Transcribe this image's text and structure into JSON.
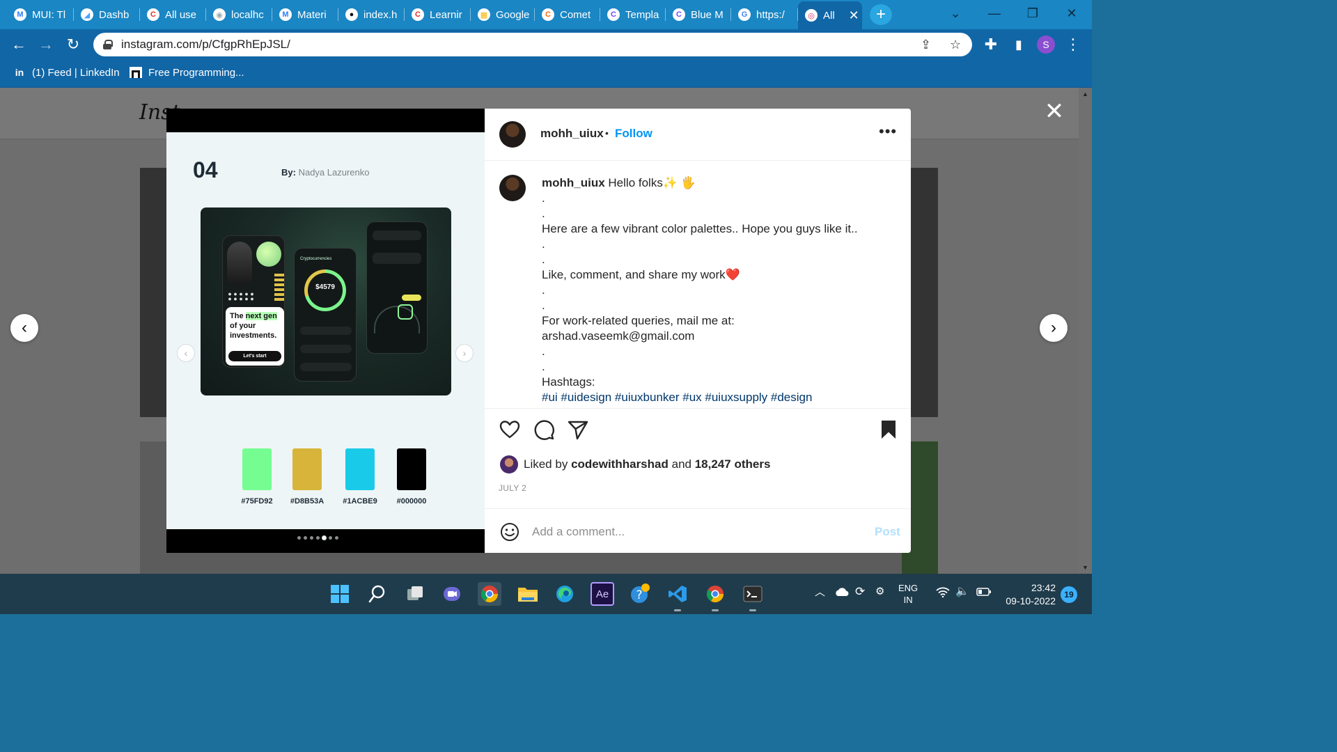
{
  "browser": {
    "tabs": [
      {
        "title": "MUI: Tl",
        "icon": "mui-icon",
        "color": "#2a7fff"
      },
      {
        "title": "Dashb",
        "icon": "dashboard-icon",
        "color": "#4da3ff"
      },
      {
        "title": "All use",
        "icon": "c-icon",
        "color": "#e0322b"
      },
      {
        "title": "localhc",
        "icon": "globe-icon",
        "color": "#9aa"
      },
      {
        "title": "Materi",
        "icon": "mui-icon",
        "color": "#2a7fff"
      },
      {
        "title": "index.h",
        "icon": "github-icon",
        "color": "#111"
      },
      {
        "title": "Learnir",
        "icon": "c-icon",
        "color": "#e0322b"
      },
      {
        "title": "Google",
        "icon": "google-sheets-icon",
        "color": "#f4b400"
      },
      {
        "title": "Comet",
        "icon": "comet-icon",
        "color": "#ff6a00"
      },
      {
        "title": "Templa",
        "icon": "c-icon",
        "color": "#6c4cff"
      },
      {
        "title": "Blue M",
        "icon": "c-icon",
        "color": "#6c4cff"
      },
      {
        "title": "https:/",
        "icon": "google-icon",
        "color": "#4285f4"
      },
      {
        "title": "All",
        "icon": "instagram-icon",
        "color": "#e1306c"
      }
    ],
    "url": "instagram.com/p/CfgpRhEpJSL/",
    "bookmarks": [
      {
        "label": "(1) Feed | LinkedIn",
        "icon": "linkedin-icon"
      },
      {
        "label": "Free Programming...",
        "icon": "bookmark-page-icon"
      }
    ],
    "profile_initial": "S"
  },
  "backdrop": {
    "logo_text": "Inst"
  },
  "post": {
    "username": "mohh_uiux",
    "follow_label": "Follow",
    "slide": {
      "number": "04",
      "by_label": "By:",
      "author": "Nadya Lazurenko",
      "mock_tagline_pre": "The ",
      "mock_tagline_hl": "next gen",
      "mock_tagline_post": " of your investments.",
      "mock_cta": "Let's start",
      "mock_amount": "$4579",
      "mock_section": "Cryptocurrencies",
      "swatches": [
        {
          "hex": "#75FD92",
          "color": "#75FD92"
        },
        {
          "hex": "#D8B53A",
          "color": "#D8B53A"
        },
        {
          "hex": "#1ACBE9",
          "color": "#1ACBE9"
        },
        {
          "hex": "#000000",
          "color": "#000000"
        }
      ],
      "pager_count": 7,
      "pager_active": 4
    },
    "caption": {
      "greeting": "Hello folks",
      "greeting_emoji": "✨ 🖐",
      "line_palettes": "Here are a few vibrant color palettes.. Hope you guys like it..",
      "line_like": "Like, comment, and share my work",
      "line_like_emoji": "❤️",
      "line_queries": "For work-related queries, mail me at:",
      "email": "arshad.vaseemk@gmail.com",
      "hashtags_label": "Hashtags:",
      "hashtags": "#ui #uidesign #uiuxbunker #ux #uiuxsupply #design",
      "dot": "."
    },
    "likes": {
      "prefix": "Liked by",
      "user": "codewithharshad",
      "middle": "and",
      "others": "18,247 others"
    },
    "date": "JULY 2",
    "comment_placeholder": "Add a comment...",
    "post_label": "Post"
  },
  "taskbar": {
    "lang_top": "ENG",
    "lang_bottom": "IN",
    "time": "23:42",
    "date": "09-10-2022",
    "notification_count": "19"
  }
}
